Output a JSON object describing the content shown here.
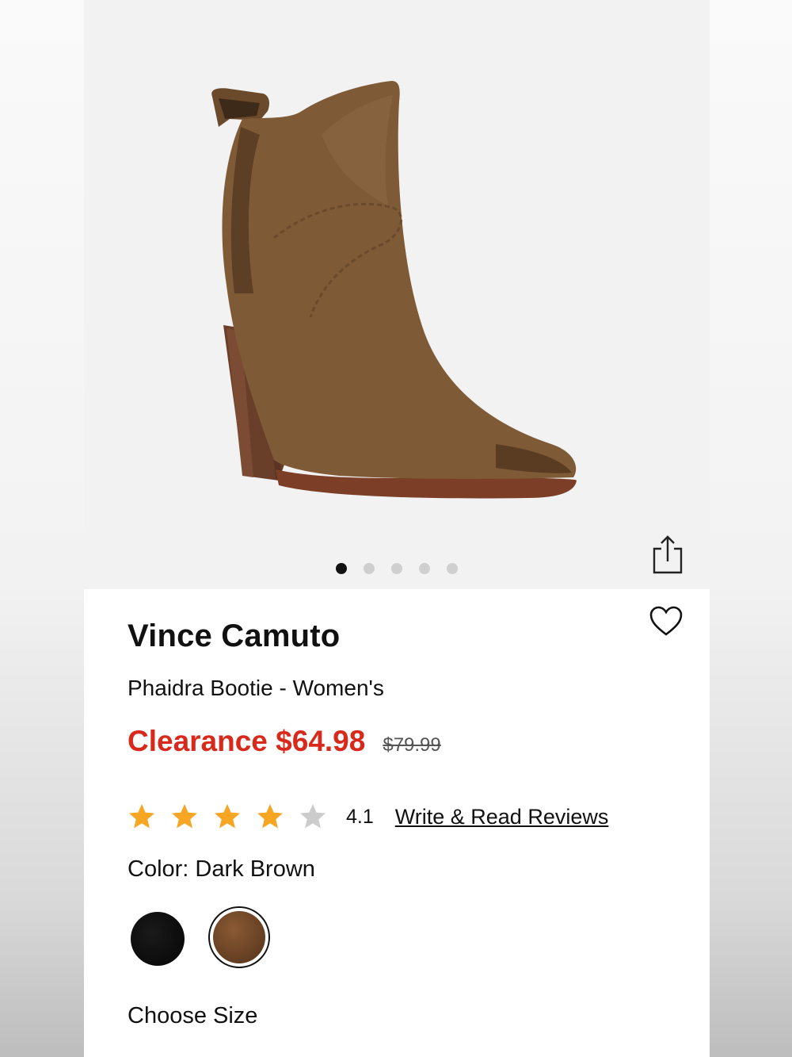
{
  "product": {
    "brand": "Vince Camuto",
    "name": "Phaidra Bootie - Women's",
    "sale_price": "Clearance $64.98",
    "original_price": "$79.99",
    "rating": 4.1,
    "rating_text": "4.1",
    "stars_filled": 4,
    "stars_total": 5,
    "reviews_link": "Write & Read Reviews",
    "color_label": "Color: Dark Brown",
    "choose_size": "Choose Size"
  },
  "gallery": {
    "image_count": 5,
    "active_index": 0
  },
  "swatches": [
    {
      "name": "Black",
      "color": "#0a0a0a",
      "selected": false
    },
    {
      "name": "Dark Brown",
      "color": "#6e4527",
      "selected": true
    }
  ],
  "colors": {
    "sale": "#d8291d",
    "star_filled": "#f6a623",
    "star_empty": "#cccccc",
    "text": "#111111"
  },
  "icons": {
    "share": "share-icon",
    "favorite": "heart-icon"
  }
}
